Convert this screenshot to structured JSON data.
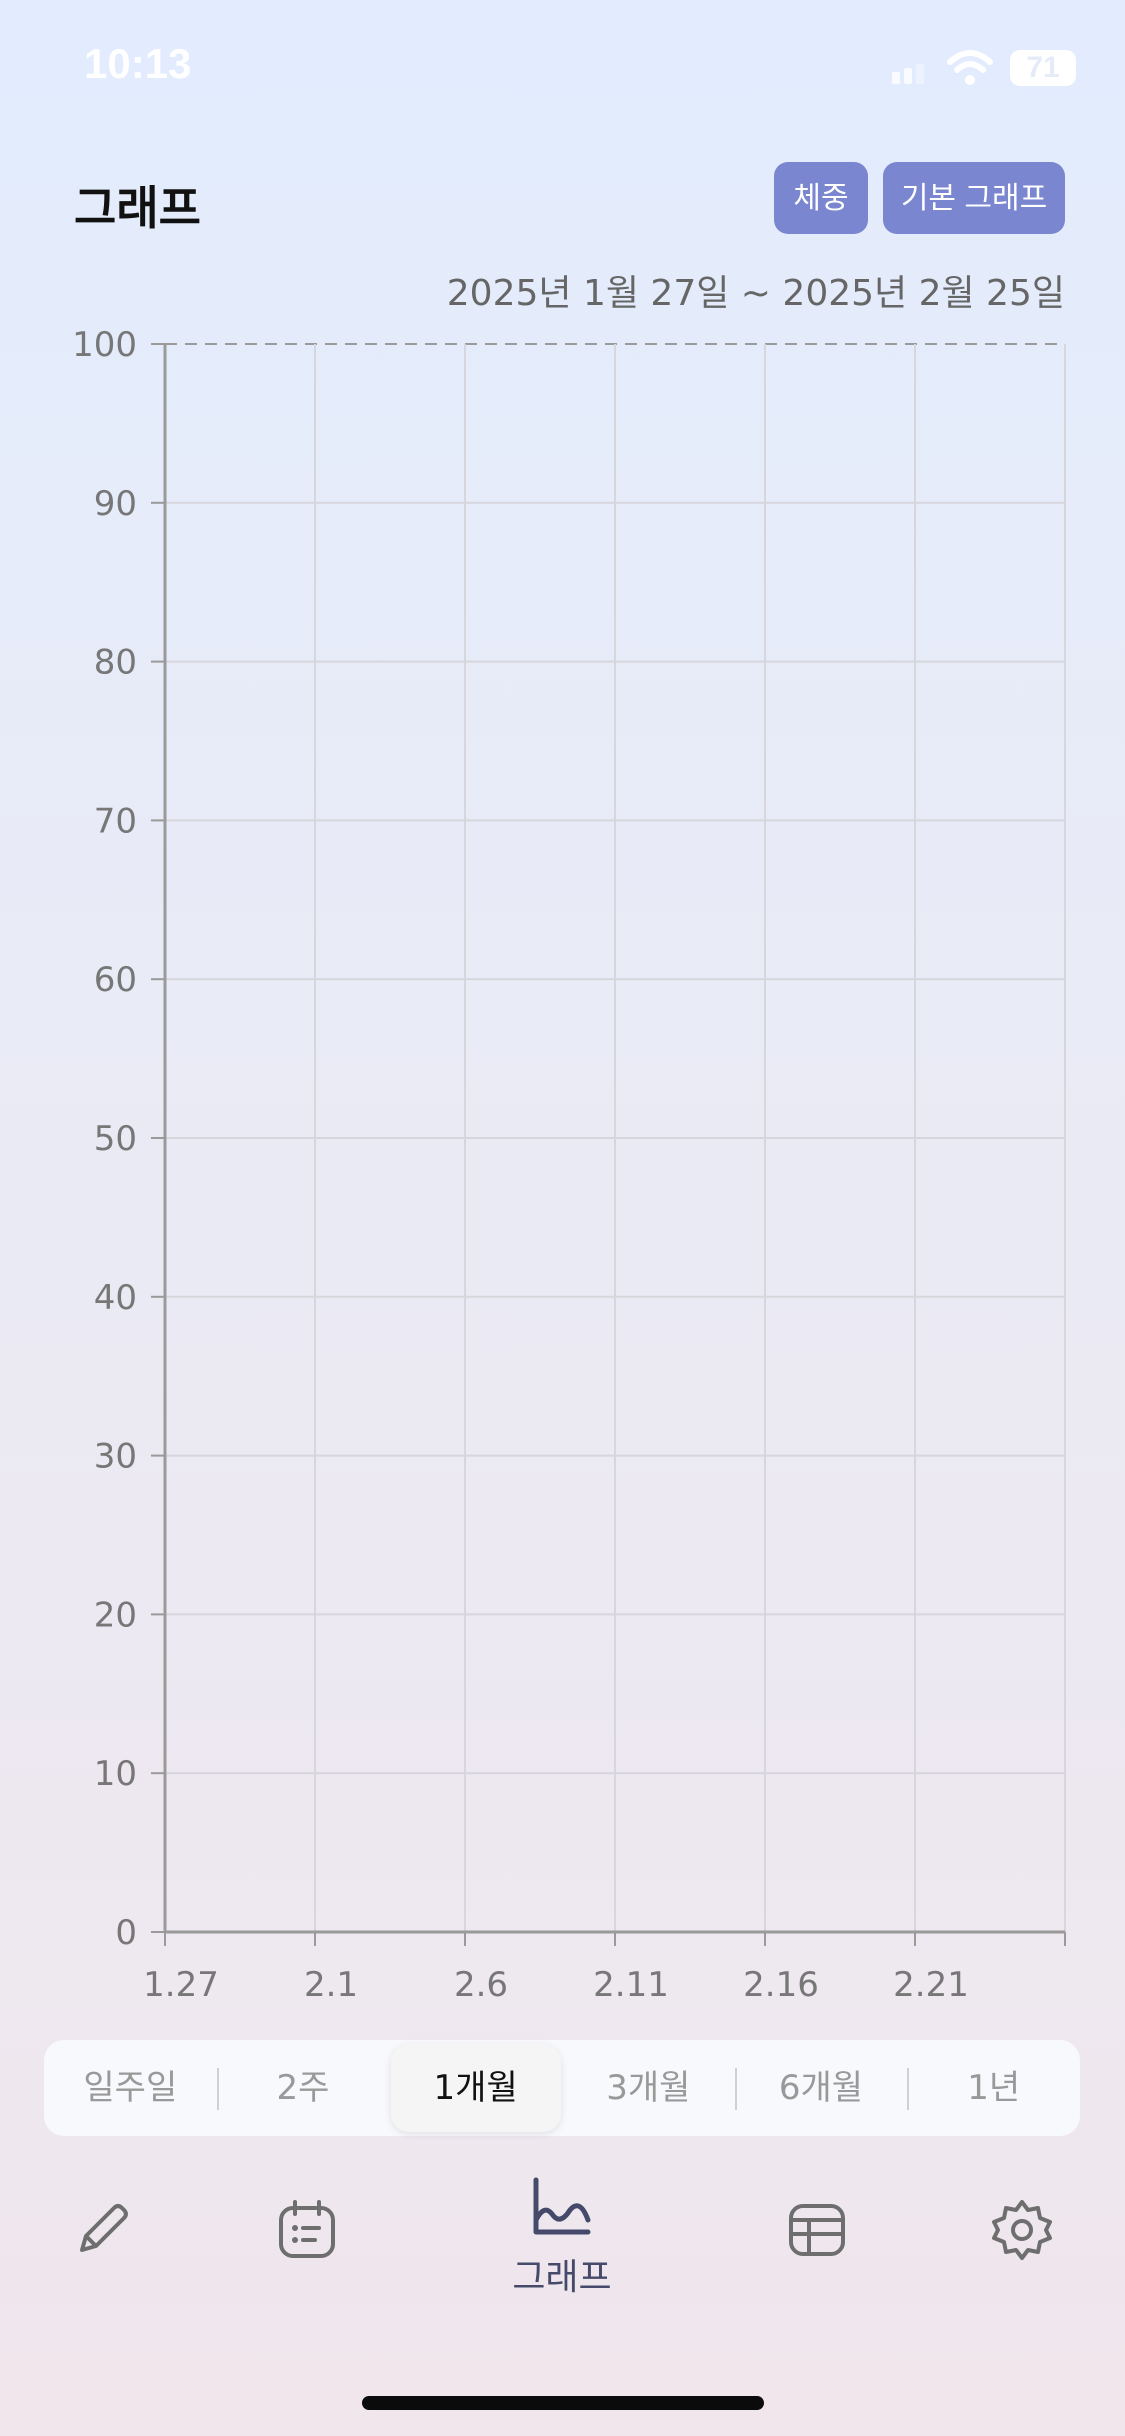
{
  "status_bar": {
    "time": "10:13",
    "battery": "71"
  },
  "header": {
    "title": "그래프",
    "weight_button": "체중",
    "basic_graph_button": "기본 그래프"
  },
  "date_range": "2025년 1월 27일 ~ 2025년 2월 25일",
  "chart_data": {
    "type": "line",
    "title": "",
    "xlabel": "",
    "ylabel": "",
    "ylim": [
      0,
      100
    ],
    "y_ticks": [
      "0",
      "10",
      "20",
      "30",
      "40",
      "50",
      "60",
      "70",
      "80",
      "90",
      "100"
    ],
    "x_ticks": [
      "1.27",
      "2.1",
      "2.6",
      "2.11",
      "2.16",
      "2.21"
    ],
    "series": [],
    "grid": true
  },
  "periods": [
    {
      "label": "일주일",
      "active": false
    },
    {
      "label": "2주",
      "active": false
    },
    {
      "label": "1개월",
      "active": true
    },
    {
      "label": "3개월",
      "active": false
    },
    {
      "label": "6개월",
      "active": false
    },
    {
      "label": "1년",
      "active": false
    }
  ],
  "tabs": [
    {
      "icon": "pencil-icon",
      "label": ""
    },
    {
      "icon": "calendar-icon",
      "label": ""
    },
    {
      "icon": "graph-icon",
      "label": "그래프"
    },
    {
      "icon": "table-icon",
      "label": ""
    },
    {
      "icon": "gear-icon",
      "label": ""
    }
  ],
  "colors": {
    "accent": "#7a86cf",
    "active_tab": "#454a6a",
    "icon": "#6e6e6e"
  }
}
